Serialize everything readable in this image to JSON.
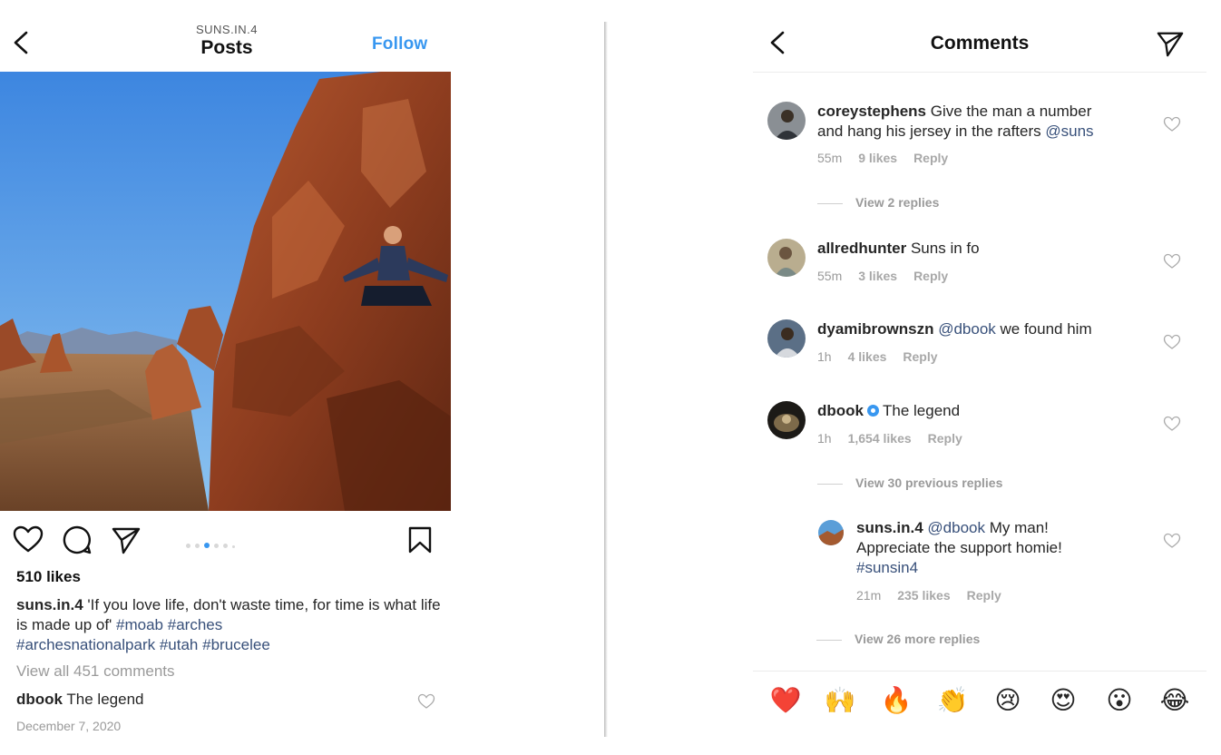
{
  "post": {
    "header": {
      "back_icon": "chevron-left-icon",
      "username": "SUNS.IN.4",
      "title": "Posts",
      "follow_label": "Follow"
    },
    "photo_description_icon": "photo",
    "actions": {
      "like_icon": "heart-icon",
      "comment_icon": "comment-icon",
      "share_icon": "send-icon",
      "save_icon": "bookmark-icon",
      "carousel_dots": 5,
      "carousel_active": 2
    },
    "likes": "510 likes",
    "caption": {
      "username": "suns.in.4",
      "text": " 'If you love life, don't waste time, for time is what life is made up of' ",
      "tags": [
        "#moab",
        "#arches",
        "#archesnationalpark",
        "#utah",
        "#brucelee"
      ]
    },
    "view_all": "View all 451 comments",
    "top_comment": {
      "username": "dbook",
      "text": " The legend"
    },
    "date": "December 7, 2020"
  },
  "comments_panel": {
    "header": {
      "back_icon": "chevron-left-icon",
      "title": "Comments",
      "send_icon": "send-icon"
    },
    "comments": [
      {
        "username": "coreystephens",
        "text_line1": " Give the man a number",
        "text_line2": "and hang his jersey in the rafters ",
        "mention": "@suns",
        "time": "55m",
        "likes": "9 likes",
        "reply": "Reply",
        "view_replies": "View 2 replies"
      },
      {
        "username": "allredhunter",
        "text": " Suns in fo",
        "time": "55m",
        "likes": "3 likes",
        "reply": "Reply"
      },
      {
        "username": "dyamibrownszn",
        "mention": "@dbook",
        "text": " we found him",
        "time": "1h",
        "likes": "4 likes",
        "reply": "Reply"
      },
      {
        "username": "dbook",
        "verified": true,
        "text": "The legend",
        "time": "1h",
        "likes": "1,654 likes",
        "reply": "Reply",
        "view_previous": "View 30 previous replies"
      }
    ],
    "reply": {
      "username": "suns.in.4",
      "mention": "@dbook",
      "text_line1": " My man!",
      "text_line2": "Appreciate the support homie!",
      "tag": "#sunsin4",
      "time": "21m",
      "likes": "235 likes",
      "reply": "Reply",
      "view_more": "View 26 more replies"
    },
    "emojis": [
      "❤️",
      "🙌",
      "🔥",
      "👏",
      "😢",
      "😍",
      "😮",
      "😂"
    ]
  },
  "colors": {
    "accent": "#3897f0",
    "link": "#38507a",
    "muted": "#9a9a9a",
    "text": "#262626"
  }
}
